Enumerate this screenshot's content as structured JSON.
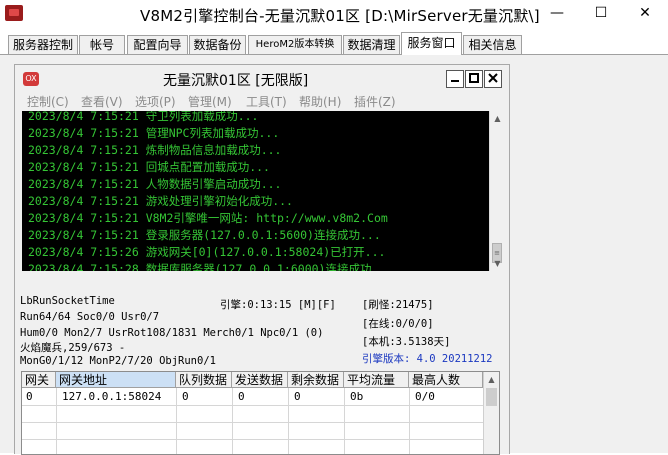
{
  "window": {
    "title": "V8M2引擎控制台-无量沉默01区 [D:\\MirServer无量沉默\\]",
    "controls": [
      "—",
      "☐",
      "✕"
    ]
  },
  "tabs": [
    {
      "label": "服务器控制"
    },
    {
      "label": "帐号"
    },
    {
      "label": "配置向导"
    },
    {
      "label": "数据备份"
    },
    {
      "label": "HeroM2版本转换"
    },
    {
      "label": "数据清理"
    },
    {
      "label": "服务窗口",
      "active": true
    },
    {
      "label": "相关信息"
    }
  ],
  "inner": {
    "icon_text": "OX",
    "title": "无量沉默01区 [无限版]",
    "menus": [
      "控制(C)",
      "查看(V)",
      "选项(P)",
      "管理(M)",
      "工具(T)",
      "帮助(H)",
      "插件(Z)"
    ]
  },
  "console_lines": [
    "2023/8/4  7:15:21  守卫列表加载成功...",
    "2023/8/4  7:15:21  管理NPC列表加载成功...",
    "2023/8/4  7:15:21  炼制物品信息加载成功...",
    "2023/8/4  7:15:21  回城点配置加载成功...",
    "2023/8/4  7:15:21  人物数据引擎启动成功...",
    "2023/8/4  7:15:21  游戏处理引擎初始化成功...",
    "2023/8/4  7:15:21  V8M2引擎唯一网站: http://www.v8m2.Com",
    "2023/8/4  7:15:21  登录服务器(127.0.0.1:5600)连接成功...",
    "2023/8/4  7:15:26  游戏网关[0](127.0.0.1:58024)已打开...",
    "2023/8/4  7:15:28  数据库服务器(127.0.0.1:6000)连接成功..."
  ],
  "status": {
    "socket_time": "LbRunSocketTime",
    "engine": "引擎:0:13:15 [M][F]",
    "refresh": "[刷怪:21475]",
    "run": "Run64/64 Soc0/0 Usr0/7",
    "online": "[在线:0/0/0]",
    "hum": "Hum0/0 Mon2/7 UsrRot108/1831 Merch0/1 Npc0/1 (0)",
    "local": "[本机:3.5138天]",
    "mob": "火焰魔兵,259/673 -",
    "version": "引擎版本: 4.0 20211212",
    "mongo": "MonG0/1/12 MonP2/7/20 ObjRun0/1"
  },
  "gateway_table": {
    "columns": [
      "网关",
      "网关地址",
      "队列数据",
      "发送数据",
      "剩余数据",
      "平均流量",
      "最高人数"
    ],
    "rows": [
      [
        "0",
        "127.0.0.1:58024",
        "0",
        "0",
        "0",
        "0b",
        "0/0"
      ]
    ]
  },
  "colors": {
    "console_bg": "#000000",
    "console_text": "#35c535",
    "version_text": "#1b38c0",
    "inner_icon": "#d23a3a"
  }
}
